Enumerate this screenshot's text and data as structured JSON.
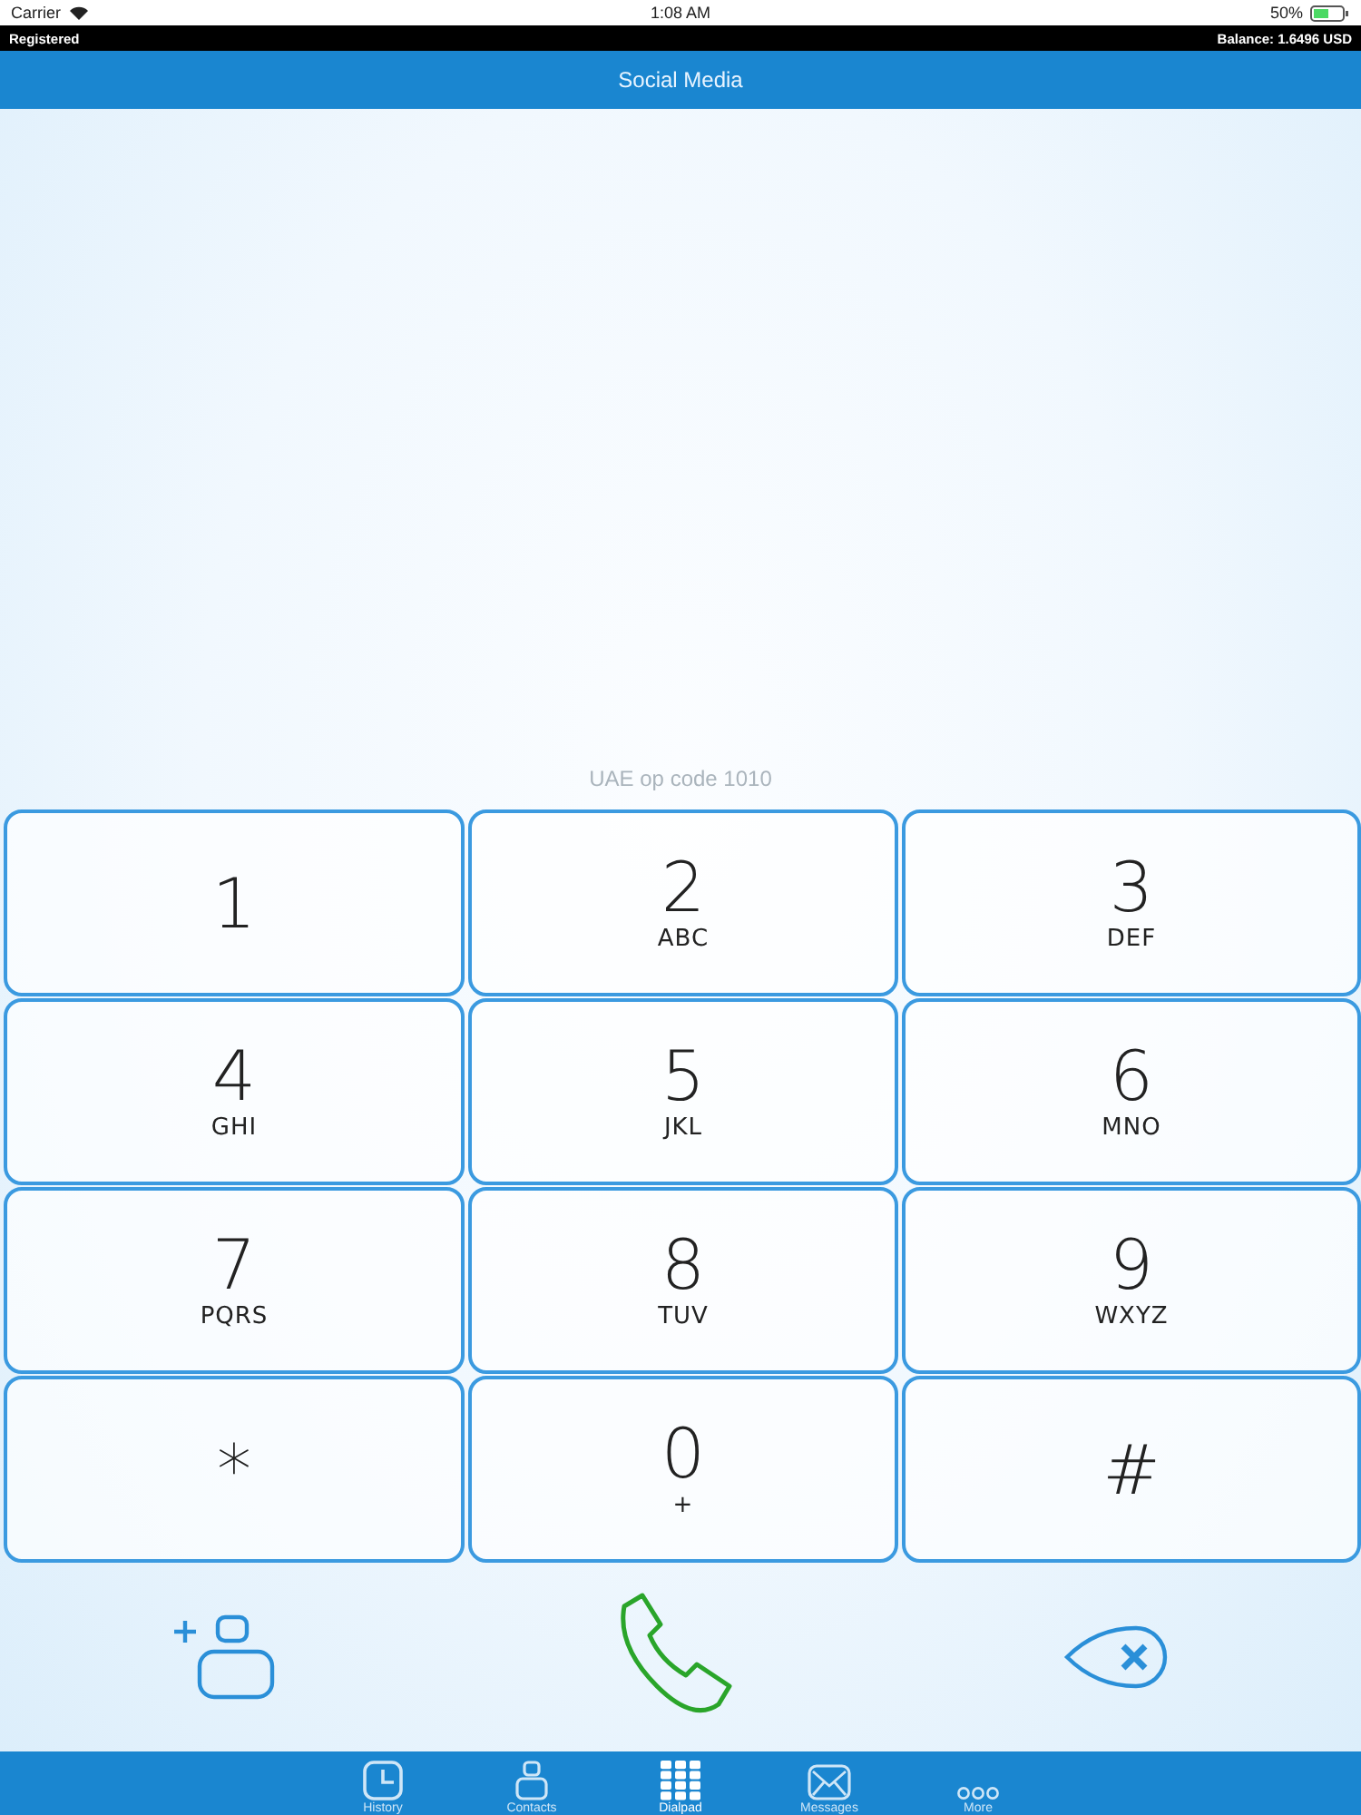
{
  "status_bar": {
    "carrier": "Carrier",
    "time": "1:08 AM",
    "battery": "50%"
  },
  "account_bar": {
    "status": "Registered",
    "balance": "Balance: 1.6496 USD"
  },
  "header": {
    "title": "Social Media"
  },
  "dial_hint": "UAE op code 1010",
  "keys": [
    {
      "digit": "1"
    },
    {
      "digit": "2",
      "letters": "ABC"
    },
    {
      "digit": "3",
      "letters": "DEF"
    },
    {
      "digit": "4",
      "letters": "GHI"
    },
    {
      "digit": "5",
      "letters": "JKL"
    },
    {
      "digit": "6",
      "letters": "MNO"
    },
    {
      "digit": "7",
      "letters": "PQRS"
    },
    {
      "digit": "8",
      "letters": "TUV"
    },
    {
      "digit": "9",
      "letters": "WXYZ"
    },
    {
      "digit": "*"
    },
    {
      "digit": "0",
      "letters": "+"
    },
    {
      "digit": "#"
    }
  ],
  "tabs": [
    {
      "label": "History",
      "kind": "clock",
      "selected": false
    },
    {
      "label": "Contacts",
      "kind": "person",
      "selected": false
    },
    {
      "label": "Dialpad",
      "kind": "grid",
      "selected": true
    },
    {
      "label": "Messages",
      "kind": "envelope",
      "selected": false
    },
    {
      "label": "More",
      "kind": "dots",
      "selected": false
    }
  ]
}
